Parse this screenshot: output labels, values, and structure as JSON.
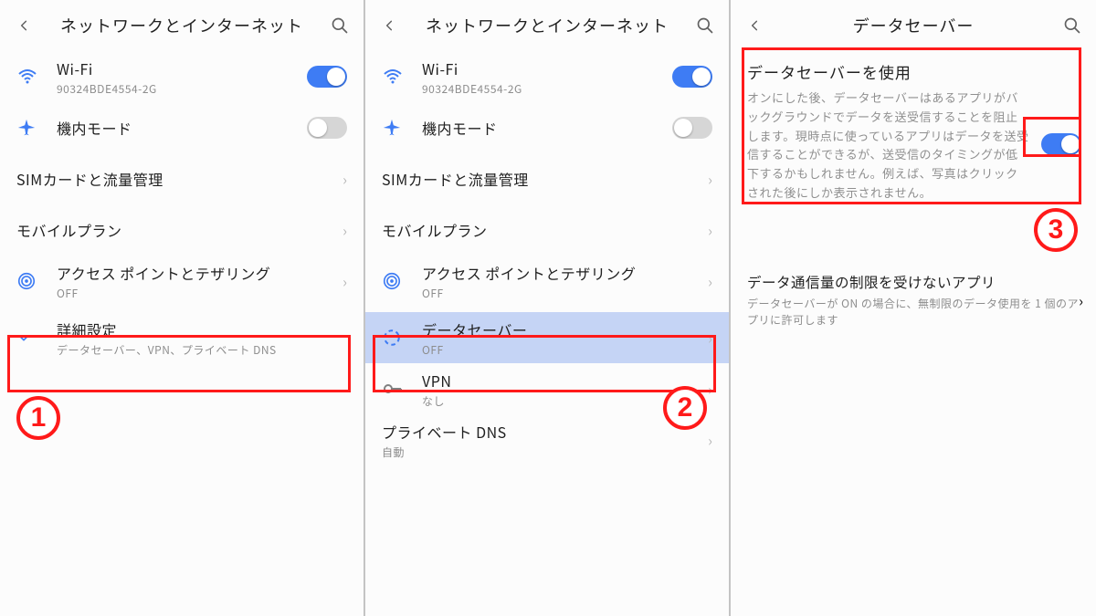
{
  "pane1": {
    "title": "ネットワークとインターネット",
    "wifi": {
      "label": "Wi-Fi",
      "sub": "90324BDE4554-2G",
      "on": true
    },
    "airplane": {
      "label": "機内モード",
      "on": false
    },
    "sim": {
      "label": "SIMカードと流量管理"
    },
    "mobile_plan": {
      "label": "モバイルプラン"
    },
    "ap": {
      "label": "アクセス ポイントとテザリング",
      "sub": "OFF"
    },
    "advanced": {
      "label": "詳細設定",
      "sub": "データセーバー、VPN、プライベート DNS"
    },
    "step": "1"
  },
  "pane2": {
    "title": "ネットワークとインターネット",
    "wifi": {
      "label": "Wi-Fi",
      "sub": "90324BDE4554-2G",
      "on": true
    },
    "airplane": {
      "label": "機内モード",
      "on": false
    },
    "sim": {
      "label": "SIMカードと流量管理"
    },
    "mobile_plan": {
      "label": "モバイルプラン"
    },
    "ap": {
      "label": "アクセス ポイントとテザリング",
      "sub": "OFF"
    },
    "datasaver": {
      "label": "データセーバー",
      "sub": "OFF"
    },
    "vpn": {
      "label": "VPN",
      "sub": "なし"
    },
    "pdns": {
      "label": "プライベート DNS",
      "sub": "自動"
    },
    "step": "2"
  },
  "pane3": {
    "title": "データセーバー",
    "use": {
      "label": "データセーバーを使用",
      "desc": "オンにした後、データセーバーはあるアプリがバックグラウンドでデータを送受信することを阻止します。現時点に使っているアプリはデータを送受信することができるが、送受信のタイミングが低下するかもしれません。例えば、写真はクリックされた後にしか表示されません。",
      "on": true
    },
    "unrestricted": {
      "label": "データ通信量の制限を受けないアプリ",
      "sub": "データセーバーが ON の場合に、無制限のデータ使用を 1 個のアプリに許可します"
    },
    "step": "3"
  }
}
